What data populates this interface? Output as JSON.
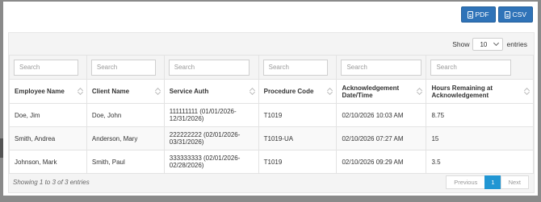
{
  "toolbar": {
    "pdf_label": "PDF",
    "csv_label": "CSV",
    "pdf_icon": "file-pdf-icon",
    "csv_icon": "file-csv-icon"
  },
  "length_menu": {
    "prefix": "Show",
    "value": "10",
    "suffix": "entries"
  },
  "filters": {
    "employee_placeholder": "Search",
    "client_placeholder": "Search",
    "service_auth_placeholder": "Search",
    "procedure_placeholder": "Search",
    "ack_placeholder": "Search",
    "hours_placeholder": "Search"
  },
  "columns": {
    "employee": "Employee Name",
    "client": "Client Name",
    "service_auth": "Service Auth",
    "procedure": "Procedure Code",
    "ack_line1": "Acknowledgement",
    "ack_line2": "Date/Time",
    "hours_line1": "Hours Remaining at",
    "hours_line2": "Acknowledgement"
  },
  "rows": [
    {
      "employee": "Doe, Jim",
      "client": "Doe, John",
      "auth_line1": "111111111 (01/01/2026-",
      "auth_line2": "12/31/2026)",
      "procedure": "T1019",
      "ack": "02/10/2026 10:03 AM",
      "hours": "8.75"
    },
    {
      "employee": "Smith, Andrea",
      "client": "Anderson, Mary",
      "auth_line1": "222222222 (02/01/2026-",
      "auth_line2": "03/31/2026)",
      "procedure": "T1019-UA",
      "ack": "02/10/2026 07:27 AM",
      "hours": "15"
    },
    {
      "employee": "Johnson, Mark",
      "client": "Smith, Paul",
      "auth_line1": "333333333 (02/01/2026-",
      "auth_line2": "02/28/2026)",
      "procedure": "T1019",
      "ack": "02/10/2026 09:29 AM",
      "hours": "3.5"
    }
  ],
  "footer": {
    "info": "Showing 1 to 3 of 3 entries",
    "previous": "Previous",
    "current_page": "1",
    "next": "Next"
  },
  "colors": {
    "accent": "#2f73b8",
    "page_active": "#2196d3"
  }
}
